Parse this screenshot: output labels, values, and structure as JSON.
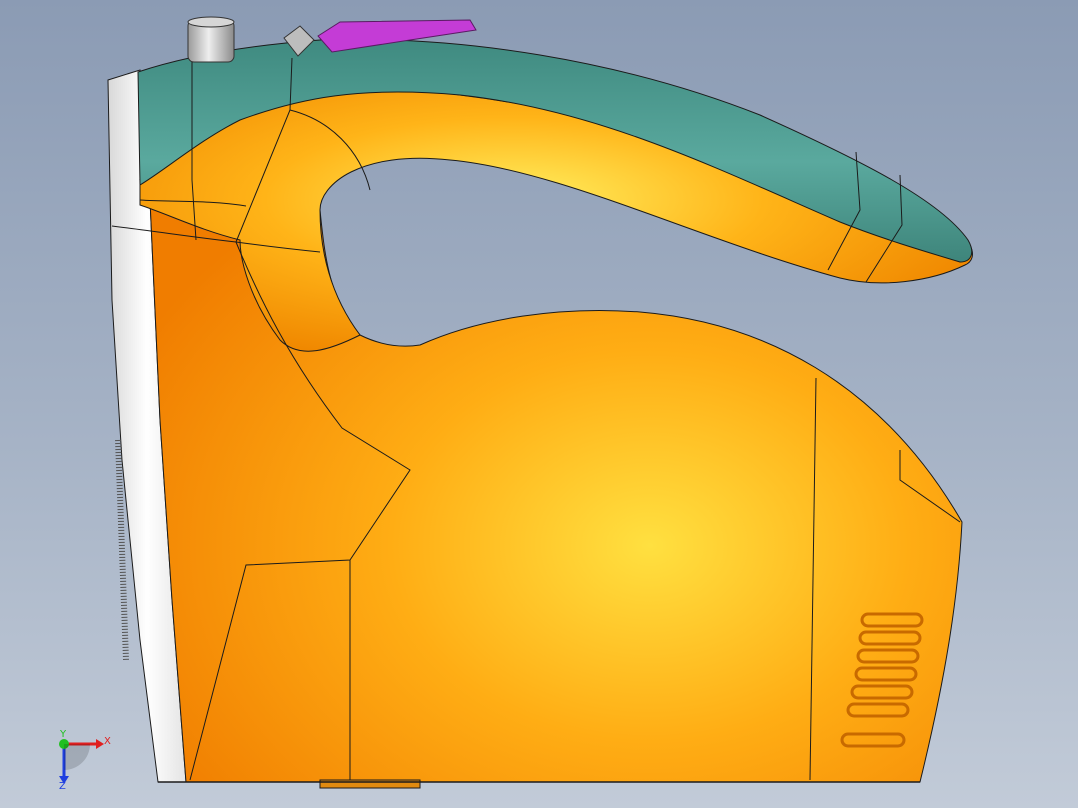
{
  "viewport": {
    "background_top": "#8b9bb4",
    "background_bottom": "#c2cbd8"
  },
  "model": {
    "body_color": "#ff9a0e",
    "handle_grip_color": "#4f9a90",
    "trigger_color": "#c43cd6",
    "soleplate_color": "#f2f2f2",
    "knob_color": "#cfcfcf",
    "edge_color": "#1b1b1b",
    "vent_slot_count": 7
  },
  "triad": {
    "x_label": "X",
    "y_label": "Y",
    "z_label": "Z",
    "x_color": "#e02020",
    "y_color": "#20c020",
    "z_color": "#2040e0"
  }
}
